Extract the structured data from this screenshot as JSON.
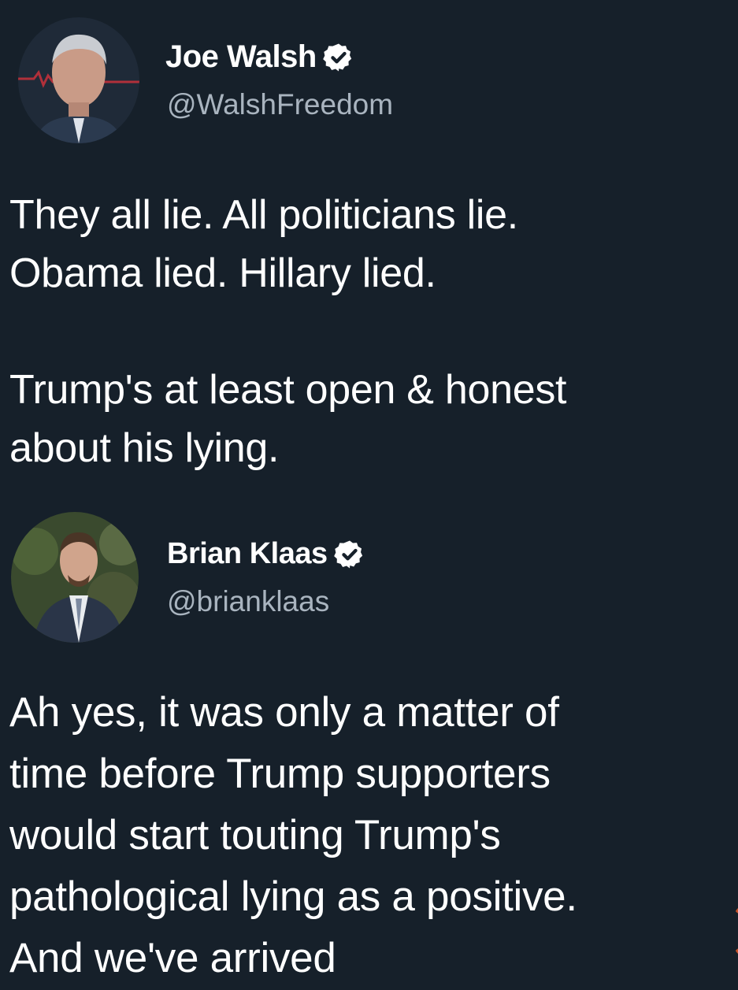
{
  "tweets": [
    {
      "display_name": "Joe Walsh",
      "handle": "@WalshFreedom",
      "verified": true,
      "avatar_icon": "profile-photo-man-gray-hair",
      "text": "They all lie. All politicians lie.\nObama lied. Hillary lied.\n\nTrump's at least open & honest\nabout his lying."
    },
    {
      "display_name": "Brian Klaas",
      "handle": "@brianklaas",
      "verified": true,
      "avatar_icon": "profile-photo-man-suit-beard",
      "text": "Ah yes, it was only a matter of\ntime before Trump supporters\nwould start touting Trump's\npathological lying as a positive.\nAnd we've arrived"
    }
  ],
  "colors": {
    "background": "#16202a",
    "text_primary": "#ffffff",
    "text_secondary": "#a9b4bf",
    "verified_badge": "#ffffff"
  }
}
